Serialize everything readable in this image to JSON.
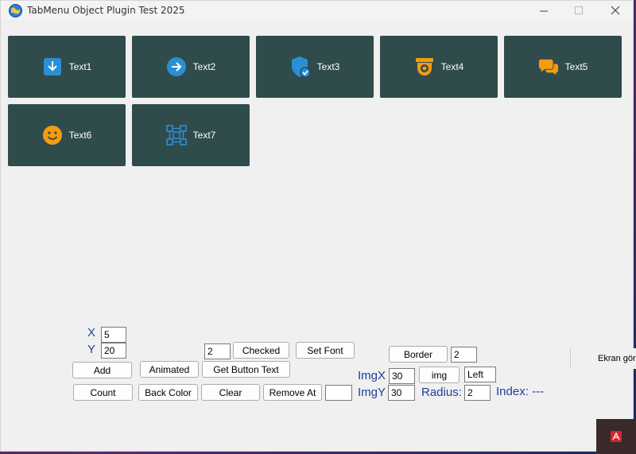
{
  "window": {
    "title": "TabMenu Object Plugin Test 2025"
  },
  "tabs": [
    {
      "label": "Text1",
      "icon": "download-icon"
    },
    {
      "label": "Text2",
      "icon": "arrow-right-circle-icon"
    },
    {
      "label": "Text3",
      "icon": "shield-check-icon"
    },
    {
      "label": "Text4",
      "icon": "security-camera-icon"
    },
    {
      "label": "Text5",
      "icon": "chat-bubbles-icon"
    },
    {
      "label": "Text6",
      "icon": "smiley-icon"
    },
    {
      "label": "Text7",
      "icon": "network-nodes-icon"
    }
  ],
  "controls": {
    "x_label": "X",
    "y_label": "Y",
    "x_value": "5",
    "y_value": "20",
    "add": "Add",
    "count": "Count",
    "animated": "Animated",
    "back_color": "Back Color",
    "index_field": "2",
    "checked": "Checked",
    "set_font": "Set Font",
    "get_button_text": "Get Button Text",
    "clear": "Clear",
    "remove_at": "Remove At",
    "remove_at_value": "",
    "border": "Border",
    "border_value": "2",
    "imgx_label": "ImgX",
    "imgy_label": "ImgY",
    "imgx_value": "30",
    "imgy_value": "30",
    "img": "img",
    "img_align": "Left",
    "radius_label": "Radius:",
    "radius_value": "2",
    "index_label": "Index: ---"
  },
  "overlay": {
    "text": "Ekran gör"
  },
  "colors": {
    "tab_bg": "#2f4b4b",
    "icon_blue": "#2b8fd6",
    "icon_orange": "#f39c12",
    "label_blue": "#1f3e9b"
  }
}
